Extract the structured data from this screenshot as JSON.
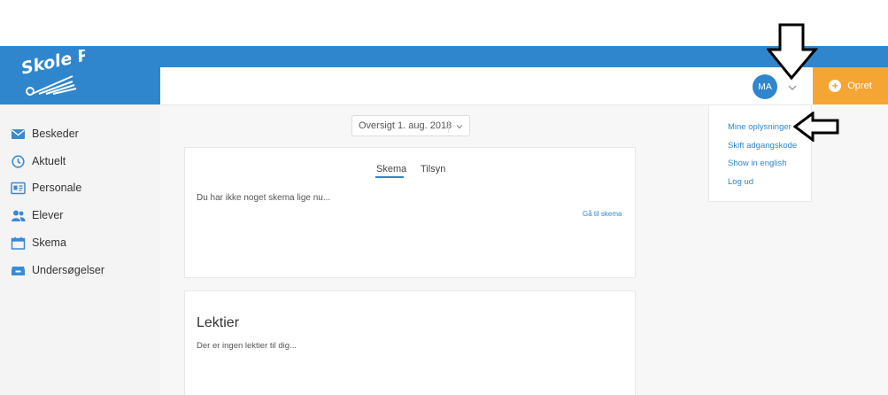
{
  "colors": {
    "brand": "#2f86cc",
    "accent": "#f5a533"
  },
  "logo": {
    "text": "Skole PLAN"
  },
  "sidebar": {
    "items": [
      {
        "label": "Beskeder",
        "icon": "envelope-icon"
      },
      {
        "label": "Aktuelt",
        "icon": "clock-icon"
      },
      {
        "label": "Personale",
        "icon": "id-card-icon"
      },
      {
        "label": "Elever",
        "icon": "users-icon"
      },
      {
        "label": "Skema",
        "icon": "calendar-icon"
      },
      {
        "label": "Undersøgelser",
        "icon": "inbox-icon"
      }
    ]
  },
  "header": {
    "avatar_initials": "MA",
    "create_label": "Opret"
  },
  "overview": {
    "label": "Oversigt 1. aug. 2018"
  },
  "schedule_card": {
    "tabs": [
      "Skema",
      "Tilsyn"
    ],
    "empty_message": "Du har ikke noget skema lige nu...",
    "link": "Gå til skema"
  },
  "homework_card": {
    "title": "Lektier",
    "empty_message": "Der er ingen lektier til dig..."
  },
  "user_menu": {
    "items": [
      "Mine oplysninger",
      "Skift adgangskode",
      "Show in english",
      "Log ud"
    ]
  }
}
